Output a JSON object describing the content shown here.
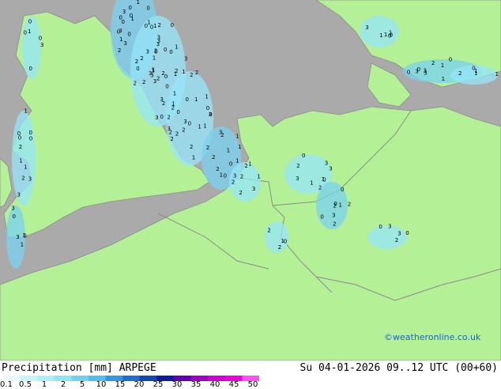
{
  "map": {
    "credit": "©weatheronline.co.uk",
    "colors": {
      "land": "#b4f096",
      "sea": "#aaaaaa",
      "precip_light": "#96e6fa",
      "precip_medium": "#78d2f0",
      "border": "#8c8c8c",
      "coast": "#8c8c8c"
    },
    "markers": [
      "0",
      "1",
      "2",
      "3",
      "4"
    ]
  },
  "footer": {
    "title_left": "Precipitation [mm] ARPEGE",
    "title_right": "Su 04-01-2026 09..12 UTC (00+60)"
  },
  "legend": {
    "ticks": [
      "0.1",
      "0.5",
      "1",
      "2",
      "5",
      "10",
      "15",
      "20",
      "25",
      "30",
      "35",
      "40",
      "45",
      "50"
    ],
    "colors": [
      "#e6fafa",
      "#c8f5fa",
      "#aaf0fa",
      "#8ce6f5",
      "#6ed2f0",
      "#50bef0",
      "#3296e6",
      "#1e6ed2",
      "#1446b4",
      "#0a1e9b",
      "#6400b4",
      "#a000c8",
      "#d200d2",
      "#f000dc",
      "#ff50f0"
    ]
  }
}
